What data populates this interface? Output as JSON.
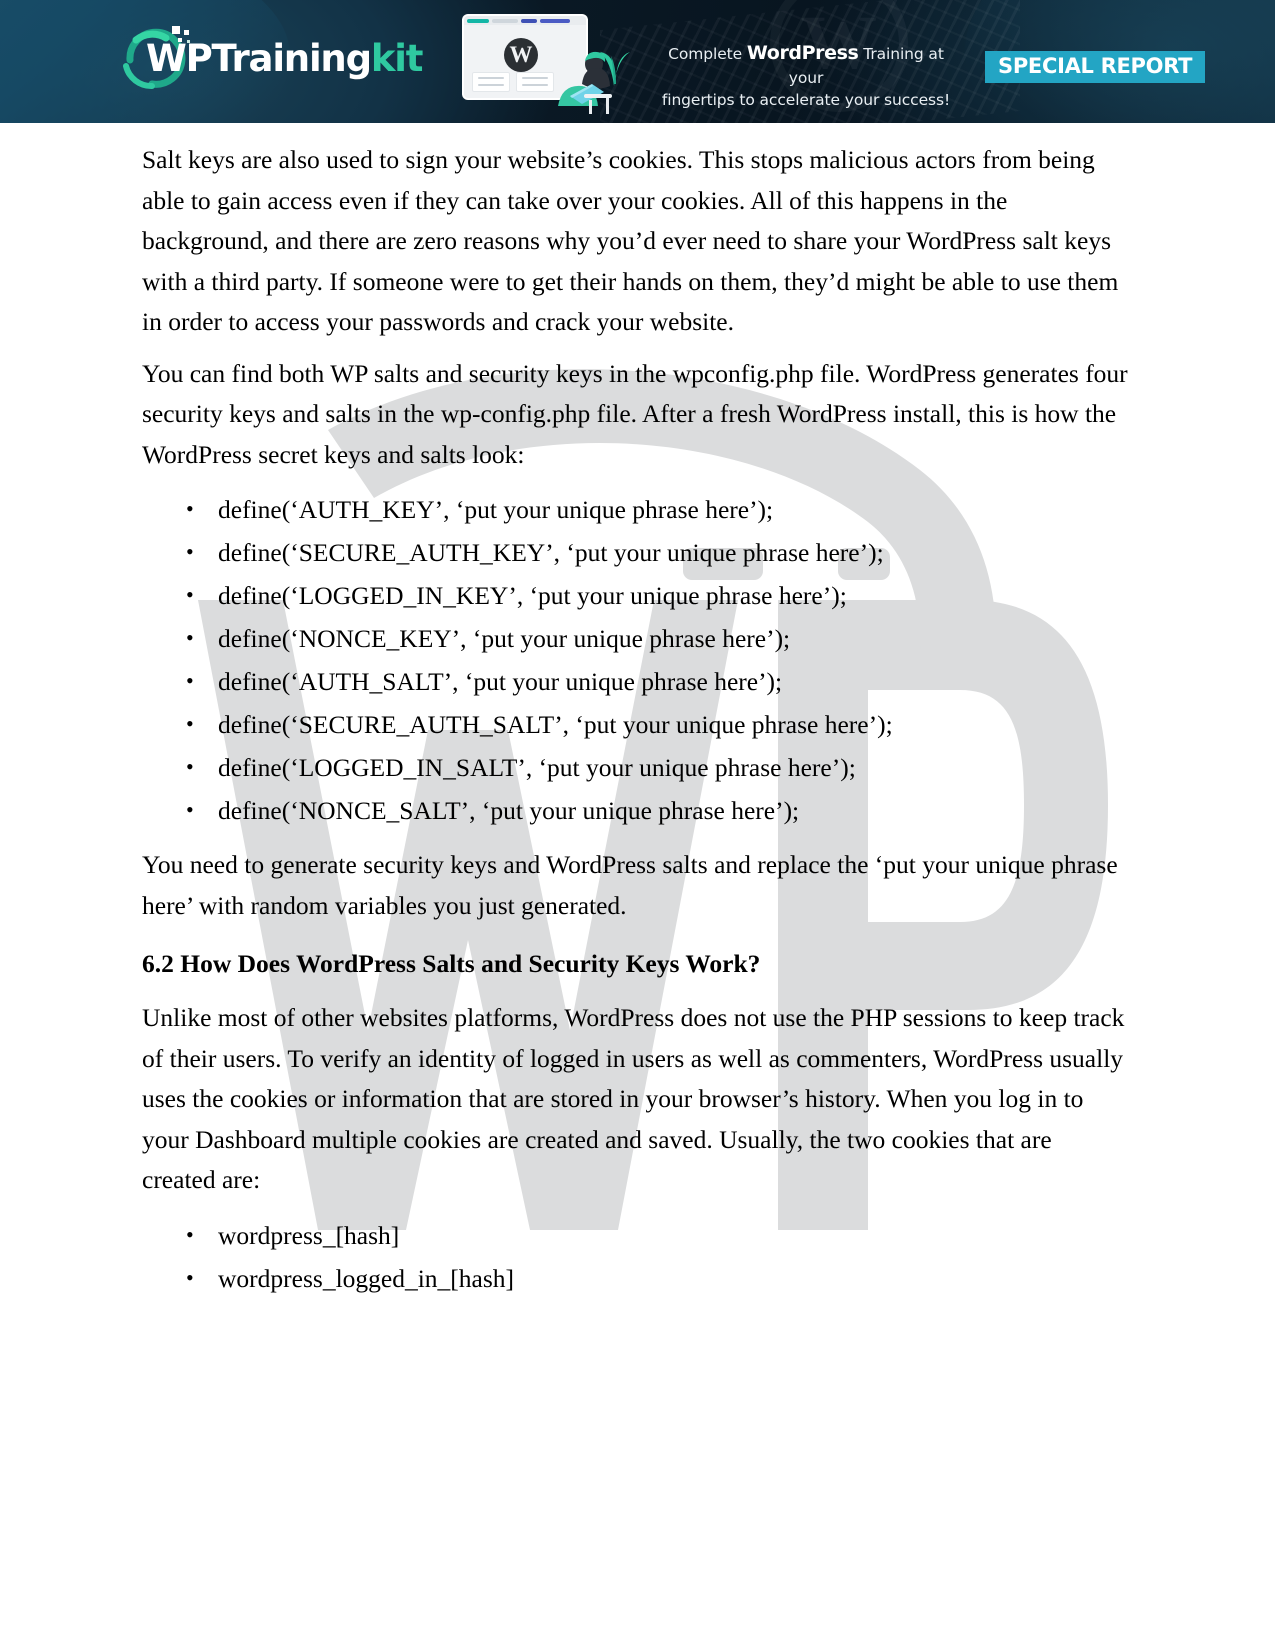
{
  "header": {
    "logo": {
      "mark_label": "wp-logo-mark",
      "text_main": "Training",
      "text_accent": "kit",
      "text_wp": "WP"
    },
    "tagline": {
      "line1_before": "Complete ",
      "line1_strong": "WordPress",
      "line1_after": " Training at your",
      "line2": "fingertips to accelerate your success!"
    },
    "badge_label": "SPECIAL REPORT",
    "illustration": {
      "wp_glyph": "W",
      "alt": "person-with-laptop-illustration"
    },
    "colors": {
      "background": "#0b1c2b",
      "badge": "#23a5c4",
      "accent_teal": "#2fc9a0"
    }
  },
  "watermark": {
    "label": "wp-watermark",
    "color": "#d9dadb"
  },
  "document": {
    "paragraph_1": "Salt keys are also used to sign your website’s cookies. This stops malicious actors from being able to gain access even if they can take over your cookies. All of this happens in the background, and there are zero reasons why you’d ever need to share your WordPress salt keys with a third party. If someone were to get their hands on them, they’d might be able to use them in order to access your passwords and crack your website.",
    "paragraph_2": "You can find both WP salts and security keys in the wpconfig.php file. WordPress generates four security keys and salts in the wp-config.php file. After a fresh WordPress install, this is how the WordPress secret keys and salts look:",
    "key_list": [
      "define(‘AUTH_KEY’, ‘put your unique phrase here’);",
      "define(‘SECURE_AUTH_KEY’, ‘put your unique phrase here’);",
      "define(‘LOGGED_IN_KEY’, ‘put your unique phrase here’);",
      "define(‘NONCE_KEY’, ‘put your unique phrase here’);",
      "define(‘AUTH_SALT’, ‘put your unique phrase here’);",
      "define(‘SECURE_AUTH_SALT’, ‘put your unique phrase here’);",
      "define(‘LOGGED_IN_SALT’, ‘put your unique phrase here’);",
      "define(‘NONCE_SALT’, ‘put your unique phrase here’);"
    ],
    "paragraph_3": "You need to generate security keys and WordPress salts and replace the ‘put your unique phrase here’ with random variables you just generated.",
    "section_heading": "6.2 How Does WordPress Salts and Security Keys Work?",
    "paragraph_4": "Unlike most of other websites platforms, WordPress does not use the PHP sessions to keep track of their users. To verify an identity of logged in users as well as commenters, WordPress usually uses the cookies or information that are stored in your browser’s history. When you log in to your Dashboard multiple cookies are created and saved. Usually, the two cookies that are created are:",
    "cookie_list": [
      "wordpress_[hash]",
      "wordpress_logged_in_[hash]"
    ]
  }
}
